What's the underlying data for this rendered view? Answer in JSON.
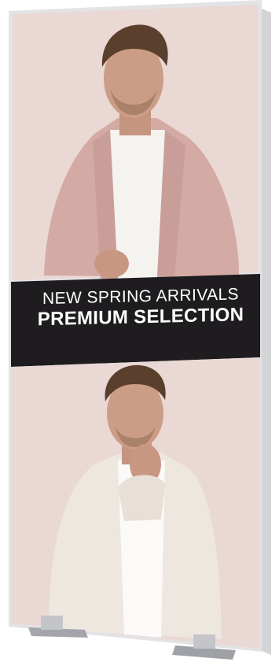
{
  "banner": {
    "headline": "NEW SPRING ARRIVALS",
    "subheadline": "PREMIUM SELECTION"
  },
  "colors": {
    "panel_background": "#e9d9d6",
    "banner_band": "#1f1d20",
    "frame_edge": "#d9d9db",
    "jacket_top": "#d7b3ad",
    "jacket_bottom": "#efe8e1",
    "shirt": "#f4f2ef",
    "skin": "#c99b84",
    "hair": "#5a3f2d",
    "feet": "#a3a5aa"
  },
  "scene": {
    "subject": "two-photo-fashion-advertising-display"
  }
}
